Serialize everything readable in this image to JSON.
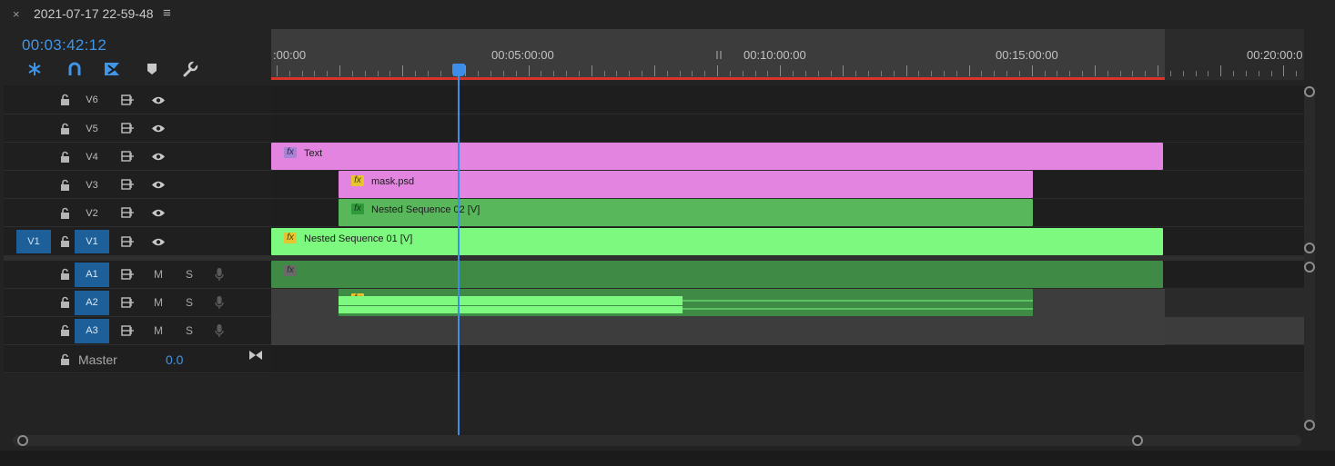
{
  "tab": {
    "close": "×",
    "title": "2021-07-17 22-59-48",
    "menu": "≡"
  },
  "timecode": "00:03:42:12",
  "toolbar": [
    "snap-icon",
    "linked-selection-icon",
    "add-marker-icon",
    "marker-icon",
    "wrench-icon"
  ],
  "ruler": {
    "labels": [
      ":00:00",
      "00:05:00:00",
      "00:10:00:00",
      "00:15:00:00",
      "00:20:00:0"
    ]
  },
  "tracks": {
    "video": [
      {
        "name": "V6"
      },
      {
        "name": "V5"
      },
      {
        "name": "V4"
      },
      {
        "name": "V3"
      },
      {
        "name": "V2"
      },
      {
        "name": "V1",
        "source": "V1"
      }
    ],
    "audio": [
      {
        "name": "A1",
        "mute": "M",
        "solo": "S"
      },
      {
        "name": "A2",
        "mute": "M",
        "solo": "S"
      },
      {
        "name": "A3",
        "mute": "M",
        "solo": "S"
      }
    ],
    "master": {
      "label": "Master",
      "value": "0.0"
    }
  },
  "clips": {
    "text": {
      "label": "Text",
      "fx": "fx"
    },
    "mask": {
      "label": "mask.psd",
      "fx": "fx"
    },
    "nested2": {
      "label": "Nested Sequence 02 [V]",
      "fx": "fx"
    },
    "nested1": {
      "label": "Nested Sequence 01 [V]",
      "fx": "fx"
    },
    "a1": {
      "fx": "fx"
    },
    "a2": {
      "fx": "fx"
    }
  },
  "colors": {
    "accent": "#3d8ee8",
    "magenta_clip": "#e384e1",
    "green_clip": "#57b75a",
    "bright_green_clip": "#7cf97e",
    "audio_clip": "#3f8a45"
  }
}
